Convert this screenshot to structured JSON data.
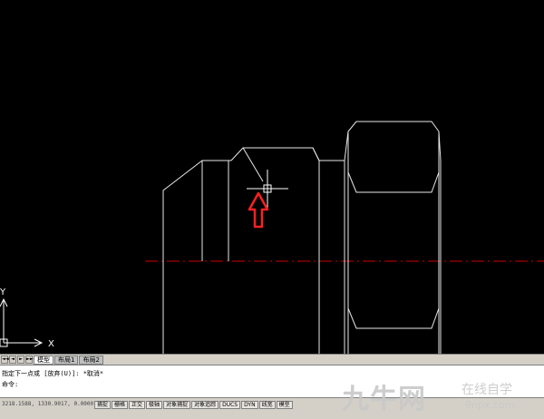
{
  "viewport": {
    "ucs_y_label": "Y",
    "ucs_x_label": "X",
    "colors": {
      "background": "#000000",
      "geometry": "#ffffff",
      "centerline": "#cc0000",
      "arrow": "#ff2020"
    }
  },
  "layout_tabs": {
    "nav": [
      "◄◄",
      "◄",
      "►",
      "►►"
    ],
    "tabs": [
      {
        "label": "模型",
        "active": true
      },
      {
        "label": "布局1",
        "active": false
      },
      {
        "label": "布局2",
        "active": false
      }
    ]
  },
  "command": {
    "line1": "指定下一点或 [放弃(U)]: *取消*",
    "line2": "命令:"
  },
  "status": {
    "coordinates": "3218.1588, 1330.9017, 0.0000",
    "toggles": [
      "捕捉",
      "栅格",
      "正交",
      "极轴",
      "对象捕捉",
      "对象追踪",
      "DUCS",
      "DYN",
      "线宽",
      "模型"
    ]
  },
  "watermark": {
    "main": "九牛网",
    "sub": "在线自学",
    "url": "9npx.com"
  }
}
